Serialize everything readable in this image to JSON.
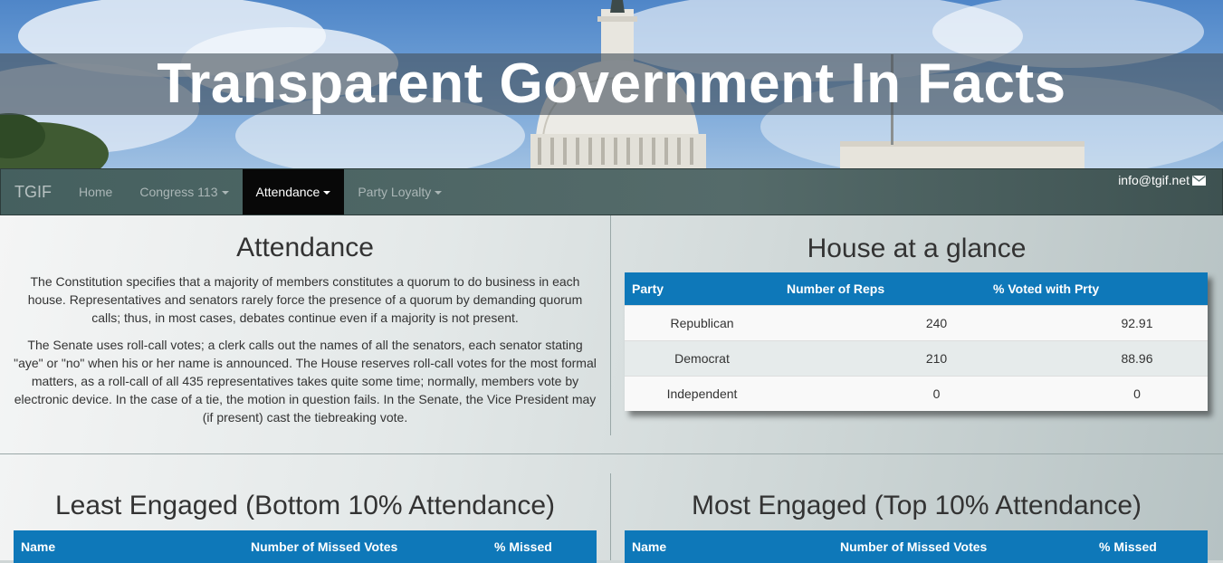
{
  "banner": {
    "title": "Transparent Government In Facts"
  },
  "navbar": {
    "brand": "TGIF",
    "items": [
      {
        "label": "Home",
        "dropdown": false,
        "active": false
      },
      {
        "label": "Congress 113",
        "dropdown": true,
        "active": false
      },
      {
        "label": "Attendance",
        "dropdown": true,
        "active": true
      },
      {
        "label": "Party Loyalty",
        "dropdown": true,
        "active": false
      }
    ],
    "email": "info@tgif.net",
    "email_icon": "envelope-icon"
  },
  "attendance": {
    "heading": "Attendance",
    "paragraphs": [
      "The Constitution specifies that a majority of members constitutes a quorum to do business in each house. Representatives and senators rarely force the presence of a quorum by demanding quorum calls; thus, in most cases, debates continue even if a majority is not present.",
      "The Senate uses roll-call votes; a clerk calls out the names of all the senators, each senator stating \"aye\" or \"no\" when his or her name is announced. The House reserves roll-call votes for the most formal matters, as a roll-call of all 435 representatives takes quite some time; normally, members vote by electronic device. In the case of a tie, the motion in question fails. In the Senate, the Vice President may (if present) cast the tiebreaking vote."
    ]
  },
  "glance": {
    "heading": "House at a glance",
    "columns": [
      "Party",
      "Number of Reps",
      "% Voted with Prty"
    ],
    "rows": [
      {
        "party": "Republican",
        "reps": "240",
        "pct": "92.91"
      },
      {
        "party": "Democrat",
        "reps": "210",
        "pct": "88.96"
      },
      {
        "party": "Independent",
        "reps": "0",
        "pct": "0"
      }
    ]
  },
  "least_engaged": {
    "heading": "Least Engaged (Bottom 10% Attendance)",
    "columns": [
      "Name",
      "Number of Missed Votes",
      "% Missed"
    ]
  },
  "most_engaged": {
    "heading": "Most Engaged (Top 10% Attendance)",
    "columns": [
      "Name",
      "Number of Missed Votes",
      "% Missed"
    ]
  },
  "colors": {
    "table_header": "#0e78b9",
    "nav_active": "#080808",
    "navbar": "#556b6a"
  }
}
